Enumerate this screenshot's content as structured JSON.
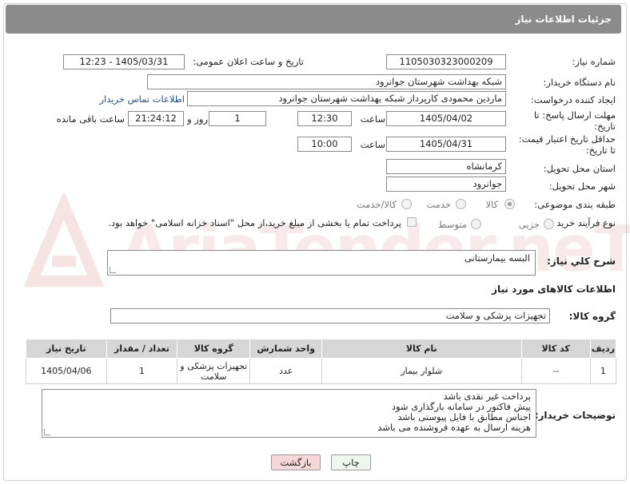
{
  "header": {
    "title": "جزئیات اطلاعات نیاز"
  },
  "fields": {
    "need_number_label": "شماره نیاز:",
    "need_number": "1105030323000209",
    "announce_label": "تاریخ و ساعت اعلان عمومی:",
    "announce_value": "1405/03/31 - 12:23",
    "buyer_org_label": "نام دستگاه خریدار:",
    "buyer_org": "شبکه بهداشت شهرستان جوانرود",
    "creator_label": "ایجاد کننده درخواست:",
    "creator": "ماردین محمودی کارپرداز شبکه بهداشت شهرستان جوانرود",
    "contact_link": "اطلاعات تماس خریدار",
    "deadline_label": "مهلت ارسال پاسخ: تا تاریخ:",
    "deadline_date": "1405/04/02",
    "time_label": "ساعت",
    "deadline_time": "12:30",
    "days_value": "1",
    "days_label": "روز و",
    "remaining_time": "21:24:12",
    "remaining_label": "ساعت باقی مانده",
    "validity_label": "حداقل تاریخ اعتبار قیمت: تا تاریخ:",
    "validity_date": "1405/04/31",
    "validity_time": "10:00",
    "province_label": "استان محل تحویل:",
    "province": "کرمانشاه",
    "city_label": "شهر محل تحویل:",
    "city": "جوانرود",
    "category_label": "طبقه بندی موضوعی:",
    "category_options": [
      "کالا",
      "خدمت",
      "کالا/خدمت"
    ],
    "process_label": "نوع فرآیند خرید :",
    "process_options": [
      "جزیی",
      "متوسط"
    ],
    "payment_note": "پرداخت تمام یا بخشی از مبلغ خرید،از محل \"اسناد خزانه اسلامی\" خواهد بود."
  },
  "description": {
    "label": "شرح کلي نياز:",
    "value": "البسه بیمارستانی"
  },
  "goods": {
    "section_title": "اطلاعات کالاهای مورد نیاز",
    "group_label": "گروه کالا:",
    "group_value": "تجهیزات پزشکی و سلامت"
  },
  "table": {
    "headers": [
      "ردیف",
      "کد کالا",
      "نام کالا",
      "واحد شمارش",
      "گروه کالا",
      "تعداد / مقدار",
      "تاریخ نیاز"
    ],
    "rows": [
      [
        "1",
        "--",
        "شلوار بیمار",
        "عدد",
        "تجهیزات پزشکی و سلامت",
        "1",
        "1405/04/06"
      ]
    ]
  },
  "buyer_notes": {
    "label": "توضیحات خریدار:",
    "lines": [
      "پرداخت غیر نقدی  باشد",
      "پیش فاکتور در سامانه بارگذاری شود",
      "اجناس مطابق با فایل پیوستی باشد",
      "هزینه ارسال به عهده فروشنده می باشد"
    ]
  },
  "buttons": {
    "print": "چاپ",
    "back": "بازگشت"
  },
  "watermark": {
    "text": "AriaTender.neT"
  },
  "colors": {
    "header_bg": "#8b8b8b",
    "link": "#1a4fa0",
    "back_btn_bg": "#f7d7d7",
    "print_btn_bg": "#eef7ee"
  }
}
